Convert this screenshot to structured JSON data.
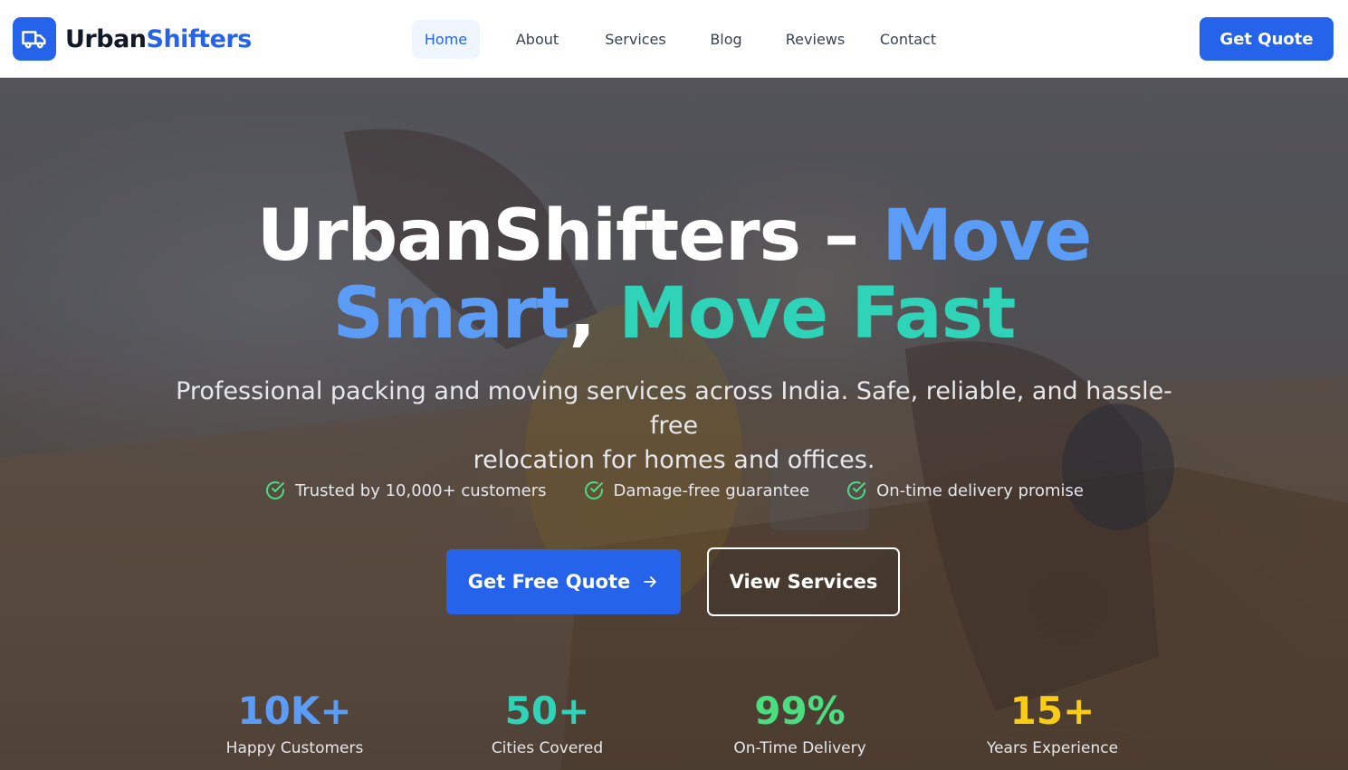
{
  "brand": {
    "name_part1": "Urban",
    "name_part2": "Shifters",
    "logo_icon": "truck-icon"
  },
  "nav": {
    "items": [
      {
        "label": "Home",
        "active": true
      },
      {
        "label": "About",
        "active": false
      },
      {
        "label": "Services",
        "active": false
      },
      {
        "label": "Blog",
        "active": false
      },
      {
        "label": "Reviews",
        "active": false
      },
      {
        "label": "Contact",
        "active": false
      }
    ]
  },
  "header": {
    "cta_label": "Get Quote"
  },
  "hero": {
    "title_part1": "UrbanShifters – ",
    "title_part2": "Move",
    "title_part3": "Smart",
    "title_part4": ", ",
    "title_part5": "Move Fast",
    "subtitle_line1": "Professional packing and moving services across India. Safe, reliable, and hassle-free",
    "subtitle_line2": "relocation for homes and offices.",
    "features": [
      {
        "label": "Trusted by 10,000+ customers",
        "icon": "check-circle-icon"
      },
      {
        "label": "Damage-free guarantee",
        "icon": "check-circle-icon"
      },
      {
        "label": "On-time delivery promise",
        "icon": "check-circle-icon"
      }
    ],
    "primary_cta": "Get Free Quote",
    "secondary_cta": "View Services"
  },
  "stats": [
    {
      "value": "10K+",
      "label": "Happy Customers",
      "color": "#5b9cf6"
    },
    {
      "value": "50+",
      "label": "Cities Covered",
      "color": "#2fd3b7"
    },
    {
      "value": "99%",
      "label": "On-Time Delivery",
      "color": "#4ade80"
    },
    {
      "value": "15+",
      "label": "Years Experience",
      "color": "#facc15"
    }
  ],
  "colors": {
    "accent": "#2563eb",
    "check": "#4ade80"
  }
}
